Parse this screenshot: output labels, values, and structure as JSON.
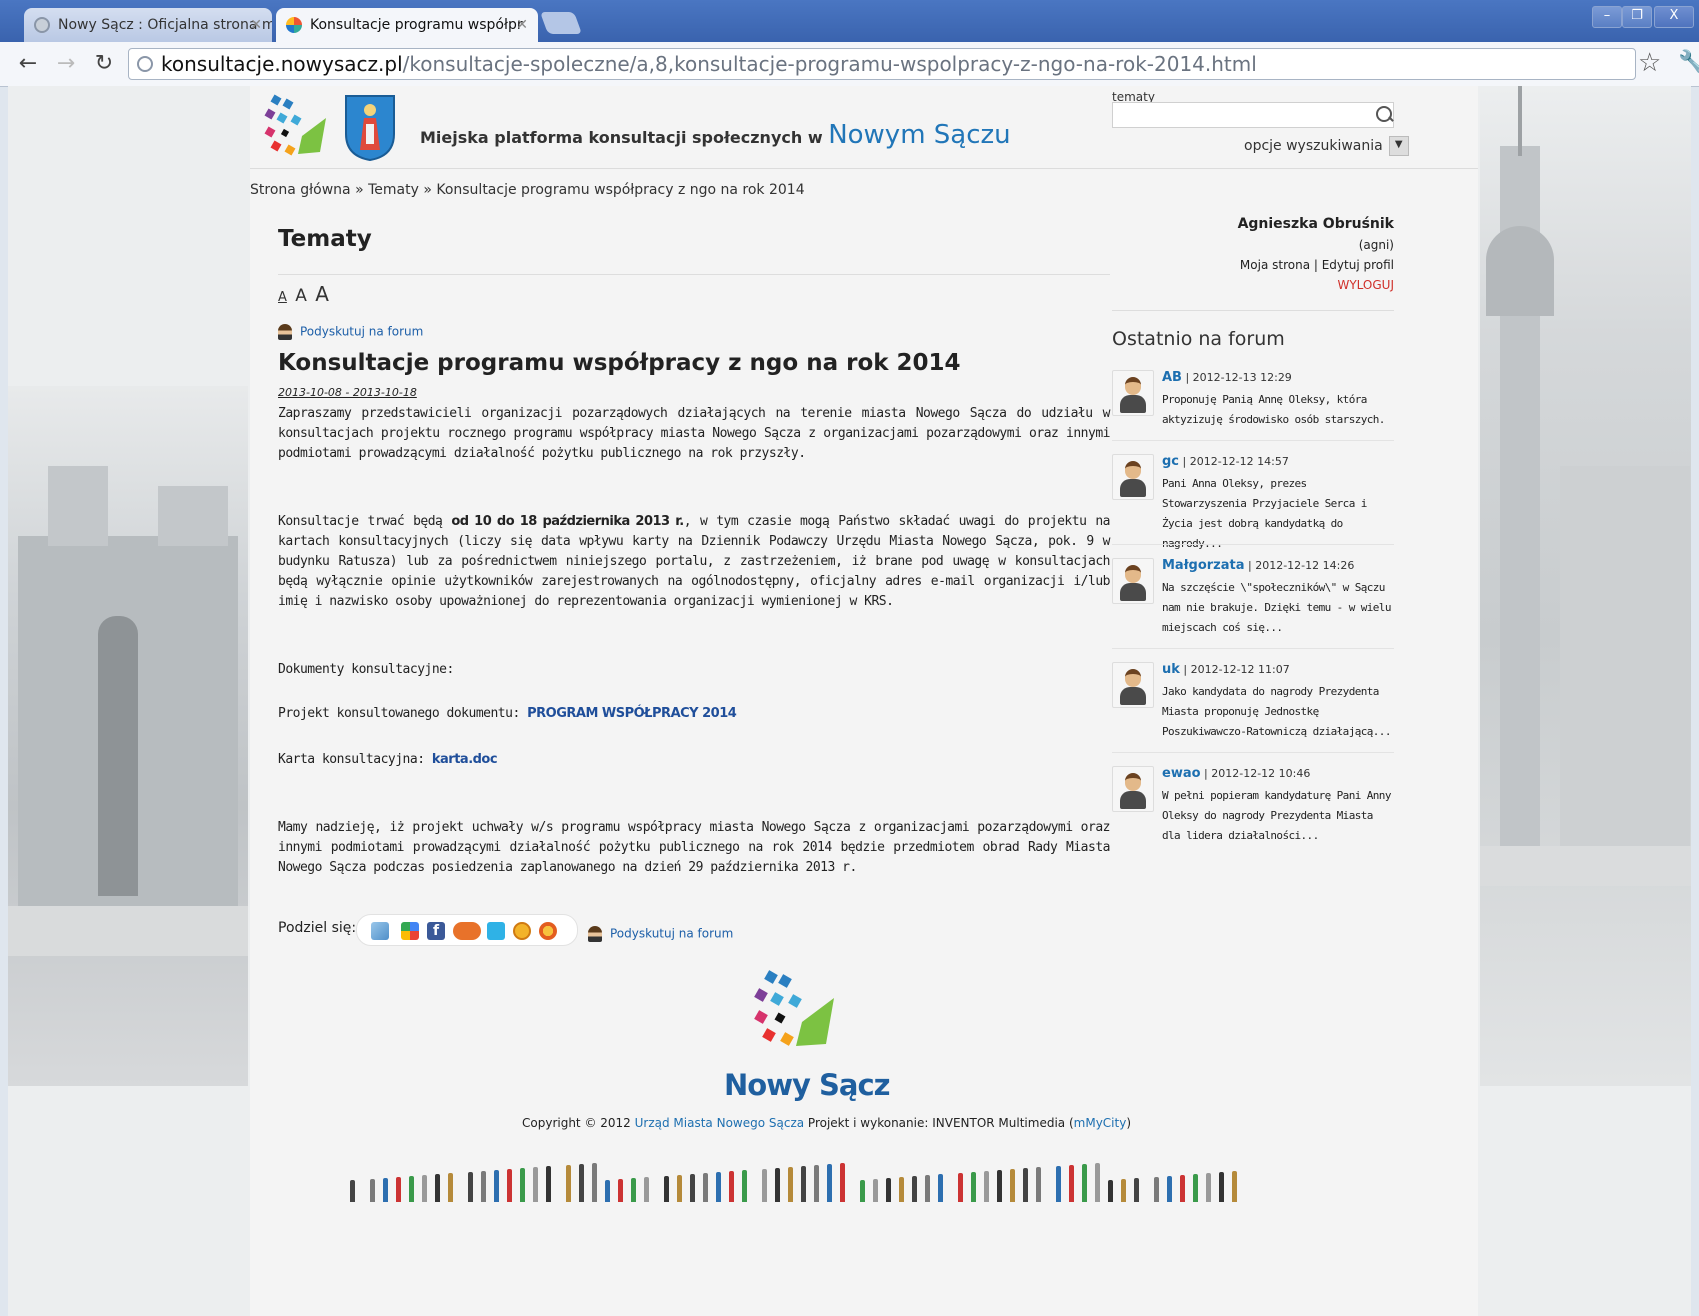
{
  "browser": {
    "tabs": [
      {
        "label": "Nowy Sącz : Oficjalna strona m",
        "active": false
      },
      {
        "label": "Konsultacje programu współpr",
        "active": true
      }
    ],
    "url_host": "konsultacje.nowysacz.pl",
    "url_path": "/konsultacje-spoleczne/a,8,konsultacje-programu-wspolpracy-z-ngo-na-rok-2014.html",
    "window_controls": [
      "–",
      "❐",
      "X"
    ]
  },
  "header": {
    "platform_text": "Miejska platforma konsultacji społecznych w",
    "platform_city": "Nowym Sączu"
  },
  "breadcrumb": "Strona główna » Tematy » Konsultacje programu współpracy z ngo na rok 2014",
  "main": {
    "heading": "Tematy",
    "font_sizes": [
      "A",
      "A",
      "A"
    ],
    "forum_link": "Podyskutuj na forum",
    "article_title": "Konsultacje programu współpracy z ngo na rok 2014",
    "dates": "2013-10-08 - 2013-10-18",
    "para1": "Zapraszamy przedstawicieli organizacji pozarządowych działających na terenie miasta Nowego Sącza do udziału w konsultacjach projektu rocznego programu współpracy miasta Nowego Sącza z organizacjami pozarządowymi oraz innymi podmiotami prowadzącymi działalność pożytku publicznego na rok przyszły.",
    "para2_a": "Konsultacje trwać będą ",
    "para2_bold": "od 10 do 18 października 2013 r.",
    "para2_b": ", w tym czasie mogą Państwo składać uwagi do projektu na kartach konsultacyjnych (liczy się data wpływu karty na Dziennik Podawczy Urzędu Miasta Nowego Sącza, pok. 9 w budynku Ratusza) lub za pośrednictwem niniejszego portalu, z zastrzeżeniem, iż brane pod uwagę w konsultacjach będą wyłącznie opinie użytkowników zarejestrowanych na ogólnodostępny, oficjalny adres e-mail organizacji i/lub imię i nazwisko osoby upoważnionej do reprezentowania organizacji wymienionej w KRS.",
    "docs_label": "Dokumenty konsultacyjne:",
    "project_label": "Projekt konsultowanego dokumentu: ",
    "project_link": "PROGRAM WSPÓŁPRACY 2014",
    "card_label": "Karta konsultacyjna: ",
    "card_link": "karta.doc",
    "para3": "Mamy nadzieję, iż projekt uchwały w/s programu współpracy miasta Nowego Sącza z organizacjami pozarządowymi oraz innymi podmiotami prowadzącymi działalność pożytku publicznego na rok 2014 będzie przedmiotem obrad Rady Miasta Nowego Sącza podczas posiedzenia zaplanowanego na dzień 29 października 2013 r.",
    "share_label": "Podziel się:",
    "share_forum_link": "Podyskutuj na forum"
  },
  "sidebar": {
    "search_label": "tematy",
    "search_value": "",
    "search_options": "opcje wyszukiwania",
    "user_name": "Agnieszka Obruśnik",
    "user_login": "(agni)",
    "my_page": "Moja strona",
    "edit_profile": "Edytuj profil",
    "logout": "WYLOGUJ",
    "forum_title": "Ostatnio na forum",
    "posts": [
      {
        "nick": "AB",
        "date": "| 2012-12-13 12:29",
        "text": "Proponuję Panią Annę Oleksy, która aktyzizuję środowisko osób starszych."
      },
      {
        "nick": "gc",
        "date": "| 2012-12-12 14:57",
        "text": "Pani Anna Oleksy, prezes Stowarzyszenia Przyjaciele Serca i Życia jest dobrą kandydatką do nagrody..."
      },
      {
        "nick": "Małgorzata",
        "date": "| 2012-12-12 14:26",
        "text": "Na szczęście \\\"społeczników\\\" w Sączu nam nie brakuje. Dzięki temu - w wielu miejscach coś się..."
      },
      {
        "nick": "uk",
        "date": "| 2012-12-12 11:07",
        "text": "Jako kandydata do nagrody Prezydenta Miasta proponuję Jednostkę Poszukiwawczo-Ratowniczą działającą..."
      },
      {
        "nick": "ewao",
        "date": "| 2012-12-12 10:46",
        "text": "W pełni popieram kandydaturę Pani Anny Oleksy do nagrody Prezydenta Miasta dla lidera działalności..."
      }
    ]
  },
  "footer": {
    "city": "Nowy Sącz",
    "copyright_a": "Copyright © 2012 ",
    "copyright_link": "Urząd Miasta Nowego Sącza",
    "copyright_b": "  Projekt i wykonanie: INVENTOR Multimedia (",
    "copyright_m": "m",
    "copyright_link2": "MyCity",
    "copyright_c": ")"
  },
  "colors": {
    "link": "#1d5fa8",
    "brand_blue": "#2176b8",
    "logout": "#d0302a",
    "chrome_blue": "#4a76c2"
  }
}
